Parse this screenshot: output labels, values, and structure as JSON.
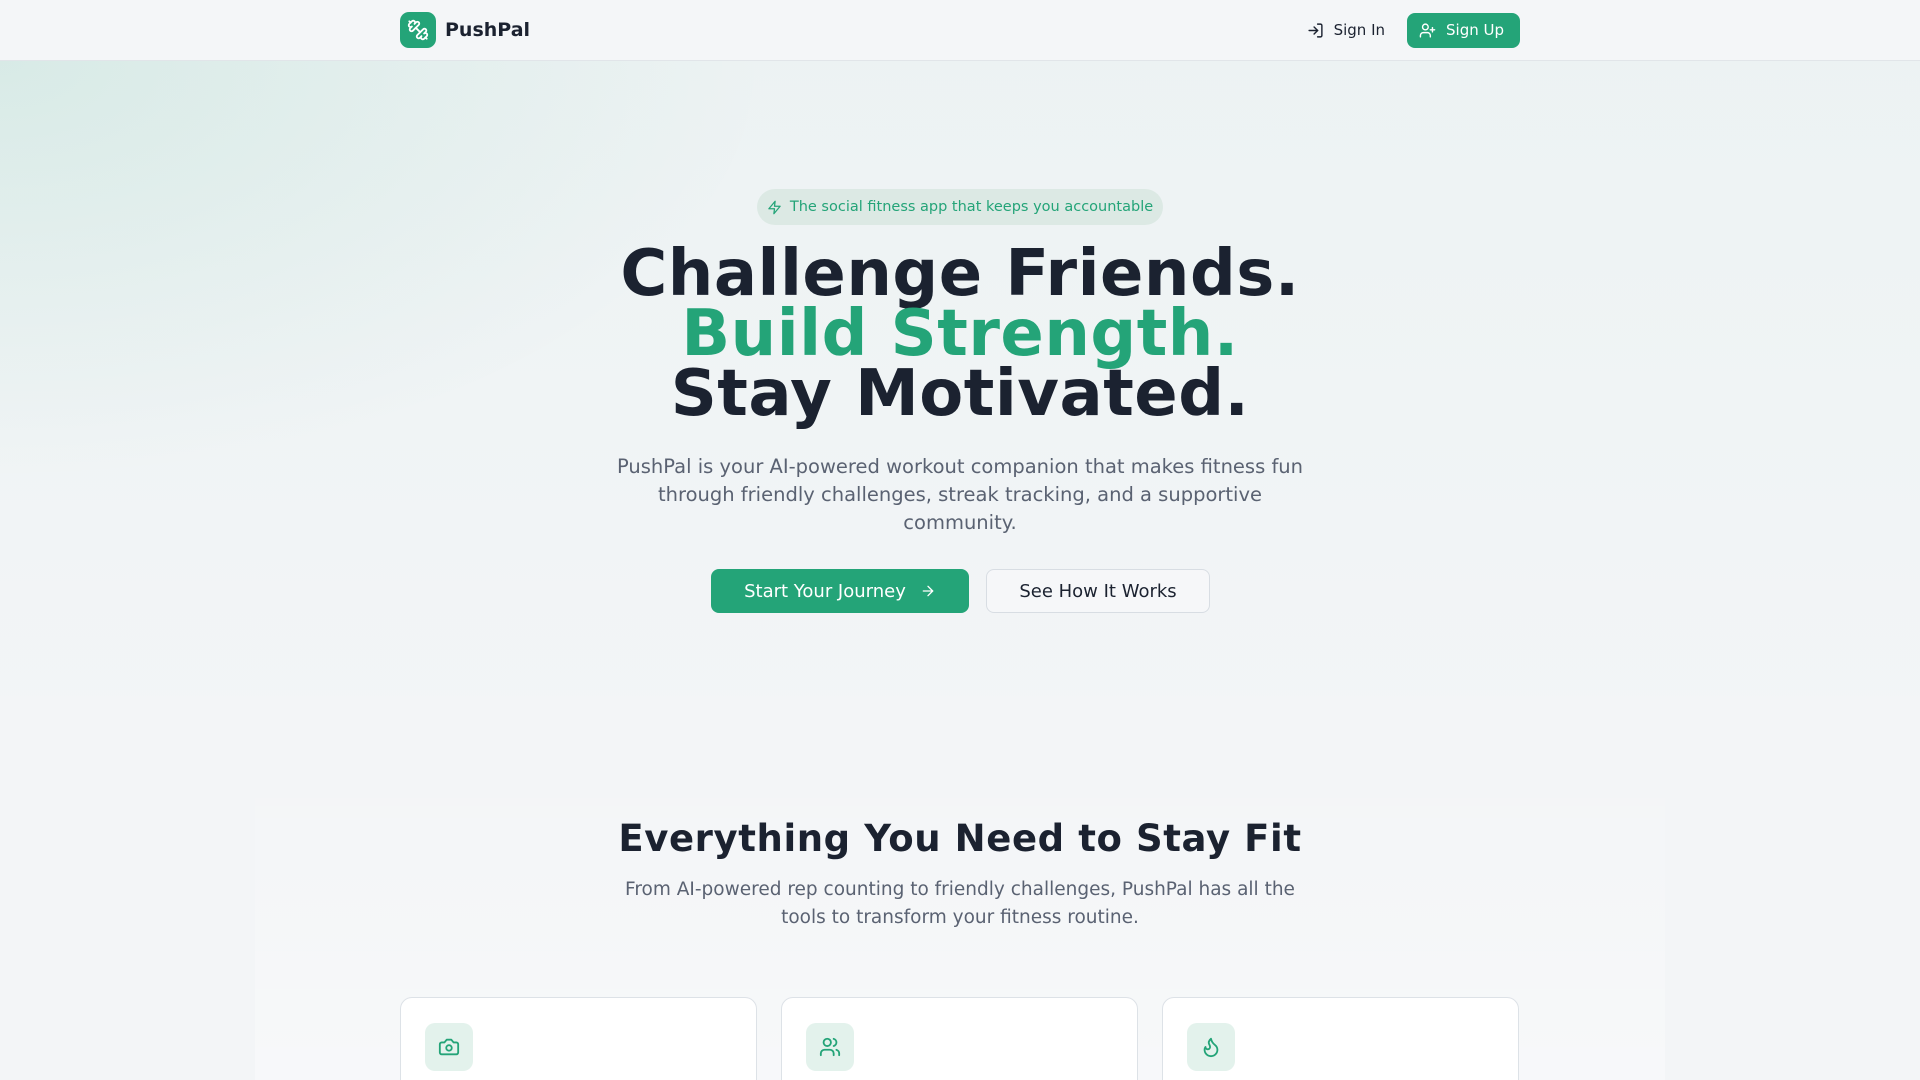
{
  "header": {
    "brand_name": "PushPal",
    "sign_in_label": "Sign In",
    "sign_up_label": "Sign Up"
  },
  "hero": {
    "badge_text": "The social fitness app that keeps you accountable",
    "headline_line1": "Challenge Friends.",
    "headline_line2": "Build Strength.",
    "headline_line3": "Stay Motivated.",
    "subtitle": "PushPal is your AI-powered workout companion that makes fitness fun through friendly challenges, streak tracking, and a supportive community.",
    "primary_cta": "Start Your Journey",
    "secondary_cta": "See How It Works"
  },
  "features": {
    "title": "Everything You Need to Stay Fit",
    "subtitle": "From AI-powered rep counting to friendly challenges, PushPal has all the tools to transform your fitness routine.",
    "cards": [
      {
        "icon": "camera-icon"
      },
      {
        "icon": "users-icon"
      },
      {
        "icon": "flame-icon"
      }
    ]
  },
  "colors": {
    "accent": "#24a478",
    "text_dark": "#1b2230",
    "text_muted": "#5a6272",
    "badge_bg": "#dce9e4"
  }
}
